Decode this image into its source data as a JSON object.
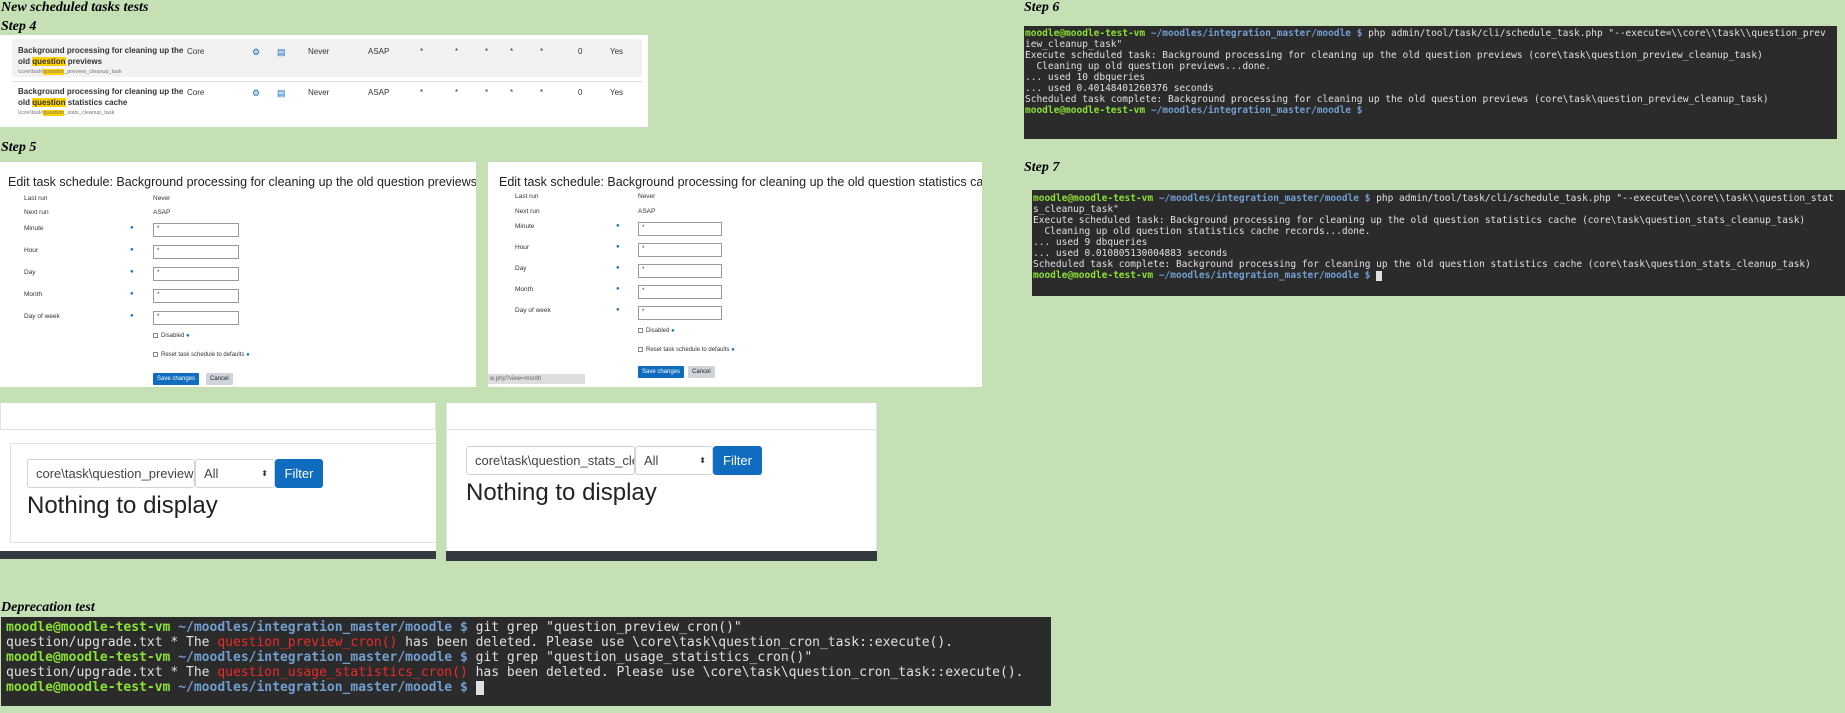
{
  "headings": {
    "title": "New scheduled tasks tests",
    "step4": "Step 4",
    "step5": "Step 5",
    "step6": "Step 6",
    "step7": "Step 7",
    "deprecation": "Deprecation test"
  },
  "step4": {
    "rows": [
      {
        "name_a": "Background processing for cleaning up the",
        "name_b1": "old ",
        "name_hl": "question",
        "name_b2": " previews",
        "sub_a": "\\core\\task\\",
        "sub_hl": "question",
        "sub_b": "_preview_cleanup_task",
        "component": "Core",
        "last_run": "Never",
        "next_run": "ASAP",
        "m": "*",
        "h": "*",
        "d": "*",
        "mo": "*",
        "dow": "*",
        "fail": "0",
        "default": "Yes"
      },
      {
        "name_a": "Background processing for cleaning up the",
        "name_b1": "old ",
        "name_hl": "question",
        "name_b2": " statistics cache",
        "sub_a": "\\core\\task\\",
        "sub_hl": "question",
        "sub_b": "_stats_cleanup_task",
        "component": "Core",
        "last_run": "Never",
        "next_run": "ASAP",
        "m": "*",
        "h": "*",
        "d": "*",
        "mo": "*",
        "dow": "*",
        "fail": "0",
        "default": "Yes"
      }
    ]
  },
  "step5": {
    "forms": [
      {
        "title": "Edit task schedule: Background processing for cleaning up the old question previews"
      },
      {
        "title": "Edit task schedule: Background processing for cleaning up the old question statistics cache"
      }
    ],
    "last_run_label": "Last run",
    "last_run_value": "Never",
    "next_run_label": "Next run",
    "next_run_value": "ASAP",
    "fields": [
      "Minute",
      "Hour",
      "Day",
      "Month",
      "Day of week"
    ],
    "field_value": "*",
    "disabled_label": "Disabled",
    "reset_label": "Reset task schedule to defaults",
    "save_label": "Save changes",
    "cancel_label": "Cancel",
    "url_fragment": "w.php?view=month"
  },
  "filters": [
    {
      "search_value": "core\\task\\question_preview_",
      "select_value": "All",
      "button": "Filter",
      "empty": "Nothing to display"
    },
    {
      "search_value": "core\\task\\question_stats_cle",
      "select_value": "All",
      "button": "Filter",
      "empty": "Nothing to display"
    }
  ],
  "step6_term": {
    "prompt_user": "moodle@moodle-test-vm",
    "prompt_path": " ~/moodles/integration_master/moodle $",
    "command": " php admin/tool/task/cli/schedule_task.php \"--execute=\\\\core\\\\task\\\\question_prev",
    "lines": [
      "iew_cleanup_task\"",
      "Execute scheduled task: Background processing for cleaning up the old question previews (core\\task\\question_preview_cleanup_task)",
      "",
      "  Cleaning up old question previews...done.",
      "... used 10 dbqueries",
      "... used 0.40148401260376 seconds",
      "Scheduled task complete: Background processing for cleaning up the old question previews (core\\task\\question_preview_cleanup_task)"
    ]
  },
  "step7_term": {
    "prompt_user": "moodle@moodle-test-vm",
    "prompt_path": " ~/moodles/integration_master/moodle $",
    "command": " php admin/tool/task/cli/schedule_task.php \"--execute=\\\\core\\\\task\\\\question_stat",
    "lines": [
      "s_cleanup_task\"",
      "Execute scheduled task: Background processing for cleaning up the old question statistics cache (core\\task\\question_stats_cleanup_task)",
      "",
      "  Cleaning up old question statistics cache records...done.",
      "... used 9 dbqueries",
      "... used 0.010805130004883 seconds",
      "Scheduled task complete: Background processing for cleaning up the old question statistics cache (core\\task\\question_stats_cleanup_task)"
    ]
  },
  "deprecation_term": {
    "prompt_user": "moodle@moodle-test-vm",
    "prompt_path": " ~/moodles/integration_master/moodle $",
    "cmd1": " git grep \"question_preview_cron()\"",
    "res1_a": "question/upgrade.txt * The ",
    "res1_hl": "question_preview_cron()",
    "res1_b": " has been deleted. Please use \\core\\task\\question_cron_task::execute().",
    "cmd2": " git grep \"question_usage_statistics_cron()\"",
    "res2_a": "question/upgrade.txt * The ",
    "res2_hl": "question_usage_statistics_cron()",
    "res2_b": " has been deleted. Please use \\core\\task\\question_cron_task::execute()."
  },
  "colors": {
    "background": "#c5e0b4",
    "primary": "#0f6cbf",
    "terminal": "#2b2b2b",
    "prompt_user": "#8ae234",
    "prompt_path": "#729fcf",
    "highlight": "#ffd200"
  }
}
